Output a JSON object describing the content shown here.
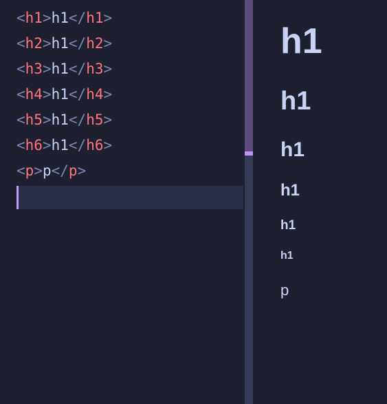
{
  "editor": {
    "lines": [
      {
        "open": "h1",
        "text": "h1",
        "close": "h1"
      },
      {
        "open": "h2",
        "text": "h1",
        "close": "h2"
      },
      {
        "open": "h3",
        "text": "h1",
        "close": "h3"
      },
      {
        "open": "h4",
        "text": "h1",
        "close": "h4"
      },
      {
        "open": "h5",
        "text": "h1",
        "close": "h5"
      },
      {
        "open": "h6",
        "text": "h1",
        "close": "h6"
      },
      {
        "open": "p",
        "text": "p",
        "close": "p"
      }
    ]
  },
  "preview": {
    "h1": "h1",
    "h2": "h1",
    "h3": "h1",
    "h4": "h1",
    "h5": "h1",
    "h6": "h1",
    "p": "p"
  },
  "colors": {
    "bg": "#1e2030",
    "fg": "#c8d3f5",
    "bracket": "#7a88b0",
    "tag": "#ff757f",
    "scroll_track": "#363a56",
    "scroll_thumb": "#5a4b7a",
    "accent": "#b794f6",
    "cursor_line": "#2a2e48"
  }
}
